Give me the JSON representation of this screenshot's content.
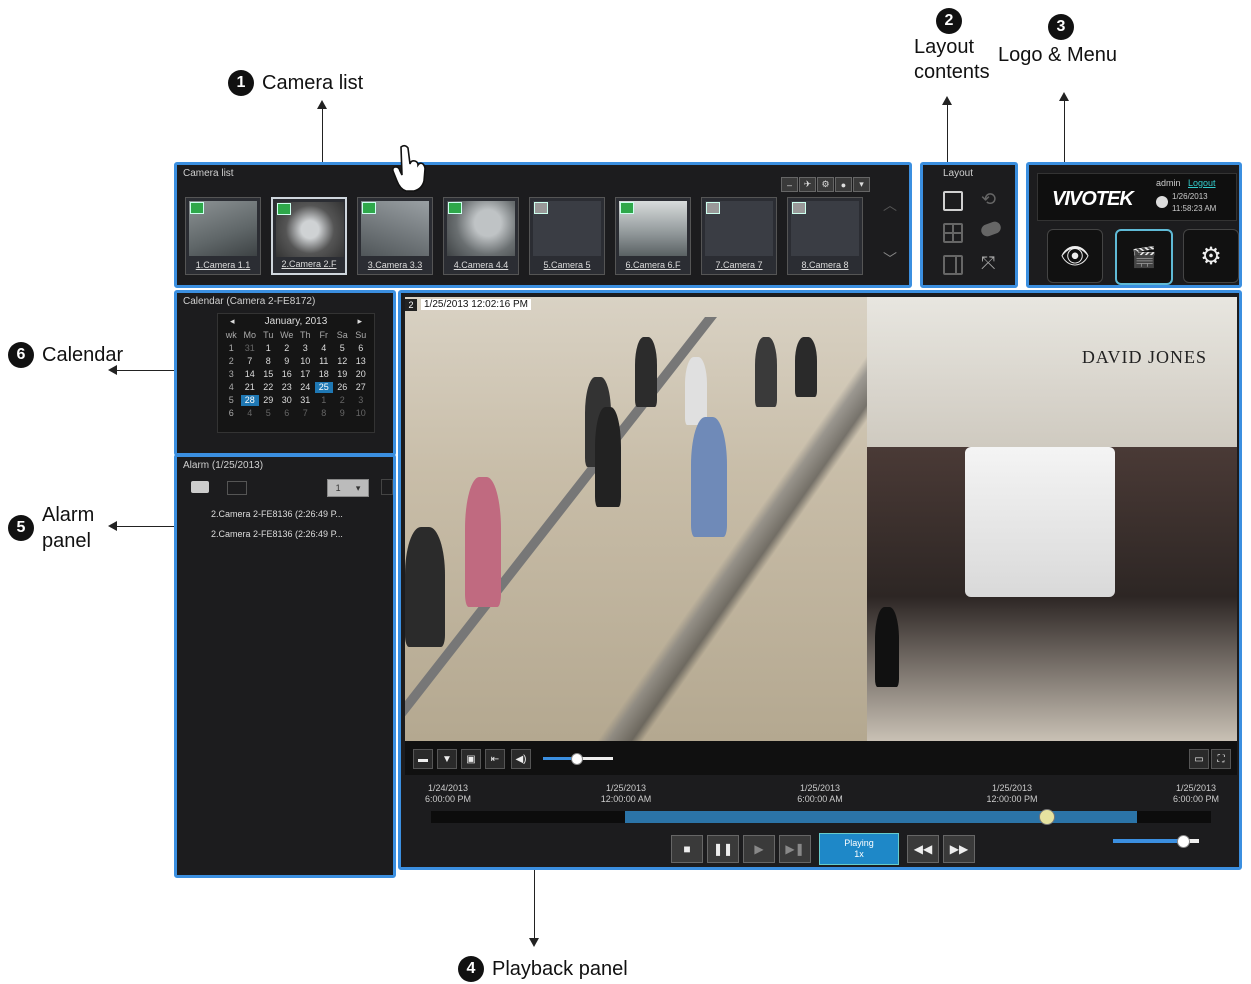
{
  "callouts": {
    "camera_list": {
      "num": "1",
      "label": "Camera list"
    },
    "layout": {
      "num": "2",
      "line1": "Layout",
      "line2": "contents"
    },
    "logo": {
      "num": "3",
      "label": "Logo & Menu"
    },
    "playback": {
      "num": "4",
      "label": "Playback panel"
    },
    "alarm": {
      "num": "5",
      "line1": "Alarm",
      "line2": "panel"
    },
    "calendar": {
      "num": "6",
      "label": "Calendar"
    }
  },
  "camera_list": {
    "title": "Camera list",
    "cameras": [
      {
        "label": "1.Camera 1.1",
        "active": true,
        "has_video": true
      },
      {
        "label": "2.Camera 2.F",
        "active": true,
        "has_video": true
      },
      {
        "label": "3.Camera 3.3",
        "active": true,
        "has_video": true
      },
      {
        "label": "4.Camera 4.4",
        "active": true,
        "has_video": true
      },
      {
        "label": "5.Camera 5",
        "active": false,
        "has_video": false
      },
      {
        "label": "6.Camera 6.F",
        "active": true,
        "has_video": true
      },
      {
        "label": "7.Camera 7",
        "active": false,
        "has_video": false
      },
      {
        "label": "8.Camera 8",
        "active": false,
        "has_video": false
      }
    ]
  },
  "layout": {
    "title": "Layout"
  },
  "logo": {
    "brand": "VIVOTEK",
    "user": "admin",
    "logout": "Logout",
    "date": "1/26/2013",
    "time": "11:58:23 AM"
  },
  "calendar": {
    "title": "Calendar (Camera 2-FE8172)",
    "month": "January, 2013",
    "weekday_header": [
      "wk",
      "Mo",
      "Tu",
      "We",
      "Th",
      "Fr",
      "Sa",
      "Su"
    ],
    "weeks": [
      [
        "1",
        "31",
        "1",
        "2",
        "3",
        "4",
        "5",
        "6"
      ],
      [
        "2",
        "7",
        "8",
        "9",
        "10",
        "11",
        "12",
        "13"
      ],
      [
        "3",
        "14",
        "15",
        "16",
        "17",
        "18",
        "19",
        "20"
      ],
      [
        "4",
        "21",
        "22",
        "23",
        "24",
        "25",
        "26",
        "27"
      ],
      [
        "5",
        "28",
        "29",
        "30",
        "31",
        "1",
        "2",
        "3"
      ],
      [
        "6",
        "4",
        "5",
        "6",
        "7",
        "8",
        "9",
        "10"
      ]
    ],
    "highlight": [
      "25",
      "28"
    ]
  },
  "alarm": {
    "title": "Alarm (1/25/2013)",
    "dropdown_value": "1",
    "items": [
      "2.Camera 2-FE8136 (2:26:49 P...",
      "2.Camera 2-FE8136 (2:26:49 P..."
    ]
  },
  "playback": {
    "channel": "2",
    "timestamp": "1/25/2013 12:02:16 PM",
    "store_sign": "DAVID JONES",
    "timeline": [
      {
        "date": "1/24/2013",
        "time": "6:00:00 PM"
      },
      {
        "date": "1/25/2013",
        "time": "12:00:00 AM"
      },
      {
        "date": "1/25/2013",
        "time": "6:00:00 AM"
      },
      {
        "date": "1/25/2013",
        "time": "12:00:00 PM"
      },
      {
        "date": "1/25/2013",
        "time": "6:00:00 PM"
      }
    ],
    "speed_line1": "Playing",
    "speed_line2": "1x"
  }
}
